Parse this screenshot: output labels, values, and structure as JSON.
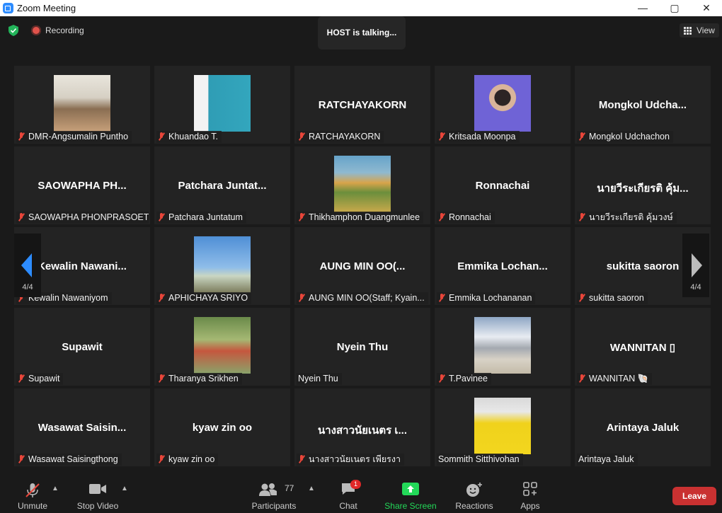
{
  "window": {
    "title": "Zoom Meeting",
    "min": "—",
    "max": "▢",
    "close": "✕"
  },
  "topbar": {
    "recording_label": "Recording",
    "talking": "HOST is talking...",
    "view_label": "View"
  },
  "page_indicator": "4/4",
  "participants": [
    {
      "display": "",
      "label": "DMR-Angsumalin Puntho",
      "muted": true,
      "photo": "woman-office"
    },
    {
      "display": "",
      "label": "Khuandao T.",
      "muted": true,
      "photo": "woman-door"
    },
    {
      "display": "RATCHAYAKORN",
      "label": "RATCHAYAKORN",
      "muted": true
    },
    {
      "display": "",
      "label": "Kritsada Moonpa",
      "muted": true,
      "photo": "man-portrait"
    },
    {
      "display": "Mongkol  Udcha...",
      "label": "Mongkol Udchachon",
      "muted": true
    },
    {
      "display": "SAOWAPHA  PH...",
      "label": "SAOWAPHA PHONPRASOET",
      "muted": true
    },
    {
      "display": "Patchara  Juntat...",
      "label": "Patchara Juntatum",
      "muted": true
    },
    {
      "display": "",
      "label": "Thikhamphon Duangmunlee",
      "muted": true,
      "photo": "painting"
    },
    {
      "display": "Ronnachai",
      "label": "Ronnachai",
      "muted": true
    },
    {
      "display": "นายวีระเกียรติ คุ้ม...",
      "label": "นายวีระเกียรติ คุ้มวงษ์",
      "muted": true
    },
    {
      "display": "Kewalin  Nawani...",
      "label": "Kewalin Nawaniyom",
      "muted": true
    },
    {
      "display": "",
      "label": "APHICHAYA SRIYO",
      "muted": true,
      "photo": "sky-person"
    },
    {
      "display": "AUNG MIN OO(...",
      "label": "AUNG MIN OO(Staff; Kyain...",
      "muted": true
    },
    {
      "display": "Emmika  Lochan...",
      "label": "Emmika Lochananan",
      "muted": true
    },
    {
      "display": "sukitta saoron",
      "label": "sukitta saoron",
      "muted": true
    },
    {
      "display": "Supawit",
      "label": "Supawit",
      "muted": true
    },
    {
      "display": "",
      "label": "Tharanya Srikhen",
      "muted": true,
      "photo": "garden-person"
    },
    {
      "display": "Nyein Thu",
      "label": "Nyein Thu",
      "muted": false
    },
    {
      "display": "",
      "label": "T.Pavinee",
      "muted": true,
      "photo": "mountain"
    },
    {
      "display": "WANNITAN ▯",
      "label": "WANNITAN 🐚",
      "muted": true
    },
    {
      "display": "Wasawat  Saisin...",
      "label": "Wasawat Saisingthong",
      "muted": true
    },
    {
      "display": "kyaw zin oo",
      "label": "kyaw zin oo",
      "muted": true
    },
    {
      "display": "นางสาวนัยเนตร เ...",
      "label": "นางสาวนัยเนตร เพียรงา",
      "muted": true
    },
    {
      "display": "",
      "label": "Sommith Sitthivohan",
      "muted": false,
      "photo": "yellow-shirt"
    },
    {
      "display": "Arintaya Jaluk",
      "label": "Arintaya Jaluk",
      "muted": false
    }
  ],
  "toolbar": {
    "unmute": "Unmute",
    "stop_video": "Stop Video",
    "participants": "Participants",
    "participants_count": "77",
    "chat": "Chat",
    "chat_badge": "1",
    "share": "Share Screen",
    "reactions": "Reactions",
    "apps": "Apps",
    "leave": "Leave"
  },
  "colors": {
    "bg": "#1a1a1a",
    "tile": "#232323",
    "share": "#23d959",
    "leave": "#c93131",
    "mute": "#e8463a"
  }
}
